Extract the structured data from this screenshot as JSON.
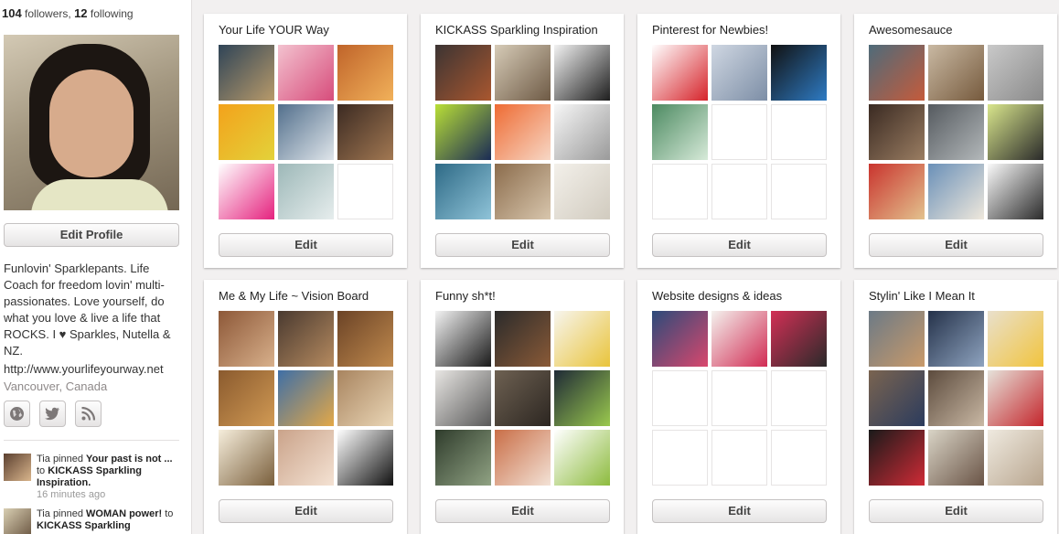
{
  "profile": {
    "followers_count": "104",
    "followers_label": "followers,",
    "following_count": "12",
    "following_label": "following",
    "edit_profile_label": "Edit Profile",
    "bio": "Funlovin' Sparklepants. Life Coach for freedom lovin' multi-passionates. Love yourself, do what you love & live a life that ROCKS. I ♥ Sparkles, Nutella & NZ.",
    "website": "http://www.yourlifeyourway.net",
    "location": "Vancouver, Canada",
    "social_icons": [
      "globe-icon",
      "twitter-icon",
      "rss-icon"
    ]
  },
  "activity": [
    {
      "actor": "Tia",
      "verb": "pinned",
      "item": "Your past is not ...",
      "connector": "to",
      "board": "KICKASS Sparkling Inspiration.",
      "time": "16 minutes ago",
      "thumb_color": "#b98f6a"
    },
    {
      "actor": "Tia",
      "verb": "pinned",
      "item": "WOMAN power!",
      "connector": "to",
      "board": "KICKASS Sparkling",
      "time": "",
      "thumb_color": "#d9cfb3"
    }
  ],
  "edit_label": "Edit",
  "boards": [
    {
      "title": "Your Life YOUR Way",
      "thumbs": [
        {
          "c1": "#2f4457",
          "c2": "#b89a6a"
        },
        {
          "c1": "#f3c2cf",
          "c2": "#d74c7b"
        },
        {
          "c1": "#c0642a",
          "c2": "#f1b15a"
        },
        {
          "c1": "#f3a21b",
          "c2": "#e3d23a"
        },
        {
          "c1": "#526f8c",
          "c2": "#dfe5ea"
        },
        {
          "c1": "#3b2a22",
          "c2": "#a27852"
        },
        {
          "c1": "#ffffff",
          "c2": "#e5227e"
        },
        {
          "c1": "#9db8b8",
          "c2": "#e6eded"
        },
        null
      ]
    },
    {
      "title": "KICKASS Sparkling Inspiration",
      "thumbs": [
        {
          "c1": "#3c3433",
          "c2": "#a9572f"
        },
        {
          "c1": "#d6cbb7",
          "c2": "#6e5a45"
        },
        {
          "c1": "#f2f2f2",
          "c2": "#1e1e1e"
        },
        {
          "c1": "#b9df37",
          "c2": "#1a2b55"
        },
        {
          "c1": "#ee6b33",
          "c2": "#f7d7c5"
        },
        {
          "c1": "#f7f7f7",
          "c2": "#9a9a9a"
        },
        {
          "c1": "#2e6a86",
          "c2": "#8fc3d8"
        },
        {
          "c1": "#8b6c4c",
          "c2": "#d8c6ad"
        },
        {
          "c1": "#f3f0ea",
          "c2": "#d1cbbf"
        }
      ]
    },
    {
      "title": "Pinterest for Newbies!",
      "thumbs": [
        {
          "c1": "#ffffff",
          "c2": "#d6232a"
        },
        {
          "c1": "#cfd7e2",
          "c2": "#7d8ea6"
        },
        {
          "c1": "#111111",
          "c2": "#2e7bc4"
        },
        {
          "c1": "#4c8a61",
          "c2": "#d7ead9"
        },
        null,
        null,
        null,
        null,
        null
      ]
    },
    {
      "title": "Awesomesauce",
      "thumbs": [
        {
          "c1": "#4e6b7a",
          "c2": "#c55b3b"
        },
        {
          "c1": "#c9b9a3",
          "c2": "#765a3d"
        },
        {
          "c1": "#c9c9c9",
          "c2": "#8a8a8a"
        },
        {
          "c1": "#3a2a22",
          "c2": "#9a7d62"
        },
        {
          "c1": "#555a5f",
          "c2": "#b3b8ba"
        },
        {
          "c1": "#d9e68c",
          "c2": "#2a2a2a"
        },
        {
          "c1": "#c9342e",
          "c2": "#e3c28e"
        },
        {
          "c1": "#6a90b8",
          "c2": "#efe8dc"
        },
        {
          "c1": "#fafafa",
          "c2": "#2b2b2b"
        }
      ]
    },
    {
      "title": "Me & My Life ~ Vision Board",
      "thumbs": [
        {
          "c1": "#8d5838",
          "c2": "#d8b08b"
        },
        {
          "c1": "#4a3a30",
          "c2": "#b58a5f"
        },
        {
          "c1": "#6b4326",
          "c2": "#c08a4e"
        },
        {
          "c1": "#8a5a2e",
          "c2": "#d19a54"
        },
        {
          "c1": "#3f6fa6",
          "c2": "#e3a848"
        },
        {
          "c1": "#a8845f",
          "c2": "#ead6b6"
        },
        {
          "c1": "#f6eedc",
          "c2": "#7a5f3c"
        },
        {
          "c1": "#caa38a",
          "c2": "#f4e2d3"
        },
        {
          "c1": "#ffffff",
          "c2": "#111111"
        }
      ]
    },
    {
      "title": "Funny sh*t!",
      "thumbs": [
        {
          "c1": "#f3f3f3",
          "c2": "#1a1a1a"
        },
        {
          "c1": "#2b2b2b",
          "c2": "#8a5a37"
        },
        {
          "c1": "#f7f5ee",
          "c2": "#e9c43b"
        },
        {
          "c1": "#e8e6e3",
          "c2": "#595959"
        },
        {
          "c1": "#6e6152",
          "c2": "#2c2621"
        },
        {
          "c1": "#1f2a36",
          "c2": "#9ac94e"
        },
        {
          "c1": "#2f3c2c",
          "c2": "#90a283"
        },
        {
          "c1": "#c96e47",
          "c2": "#f3e2d6"
        },
        {
          "c1": "#ffffff",
          "c2": "#8dbb3e"
        }
      ]
    },
    {
      "title": "Website designs & ideas",
      "thumbs": [
        {
          "c1": "#2c4a7a",
          "c2": "#d9486d"
        },
        {
          "c1": "#f4f2ee",
          "c2": "#d12b53"
        },
        {
          "c1": "#d22f55",
          "c2": "#2a2a2a"
        },
        null,
        null,
        null,
        null,
        null,
        null
      ]
    },
    {
      "title": "Stylin' Like I Mean It",
      "thumbs": [
        {
          "c1": "#6c7a86",
          "c2": "#c99a6a"
        },
        {
          "c1": "#25324a",
          "c2": "#8ea3bf"
        },
        {
          "c1": "#e9e0cc",
          "c2": "#f1c43e"
        },
        {
          "c1": "#7a6450",
          "c2": "#2b3b5d"
        },
        {
          "c1": "#5c4b3d",
          "c2": "#c9b8a4"
        },
        {
          "c1": "#e6e2da",
          "c2": "#c4262c"
        },
        {
          "c1": "#1a1a1a",
          "c2": "#cf2b36"
        },
        {
          "c1": "#d9d4c6",
          "c2": "#6a5446"
        },
        {
          "c1": "#efeae0",
          "c2": "#b8a58e"
        }
      ]
    }
  ]
}
